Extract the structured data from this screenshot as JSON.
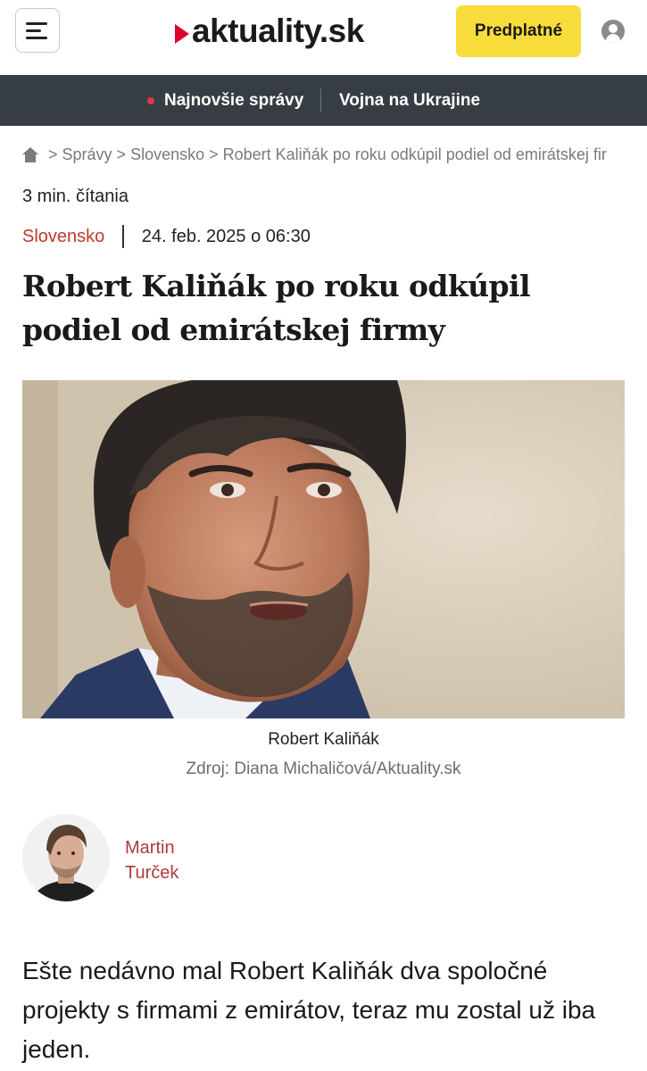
{
  "header": {
    "logo_text": "aktuality.sk",
    "subscribe_label": "Predplatné",
    "accent_color": "#e0002d",
    "subscribe_color": "#f8dc3c"
  },
  "nav": {
    "items": [
      {
        "label": "Najnovšie správy"
      },
      {
        "label": "Vojna na Ukrajine"
      }
    ],
    "background": "#363d44"
  },
  "breadcrumb": {
    "items": [
      "Správy",
      "Slovensko",
      "Robert Kaliňák po roku odkúpil podiel od emirátskej fir"
    ],
    "separator": ">"
  },
  "article": {
    "read_time": "3 min. čítania",
    "category": "Slovensko",
    "date": "24. feb. 2025 o 06:30",
    "headline": "Robert Kaliňák po roku odkúpil podiel od emirátskej firmy",
    "photo_caption": "Robert Kaliňák",
    "photo_credit": "Zdroj: Diana Michaličová/Aktuality.sk",
    "author": "Martin Turček",
    "lead": "Ešte nedávno mal Robert Kaliňák dva spoločné projekty s firmami z emirátov, teraz mu zostal už iba jeden."
  }
}
